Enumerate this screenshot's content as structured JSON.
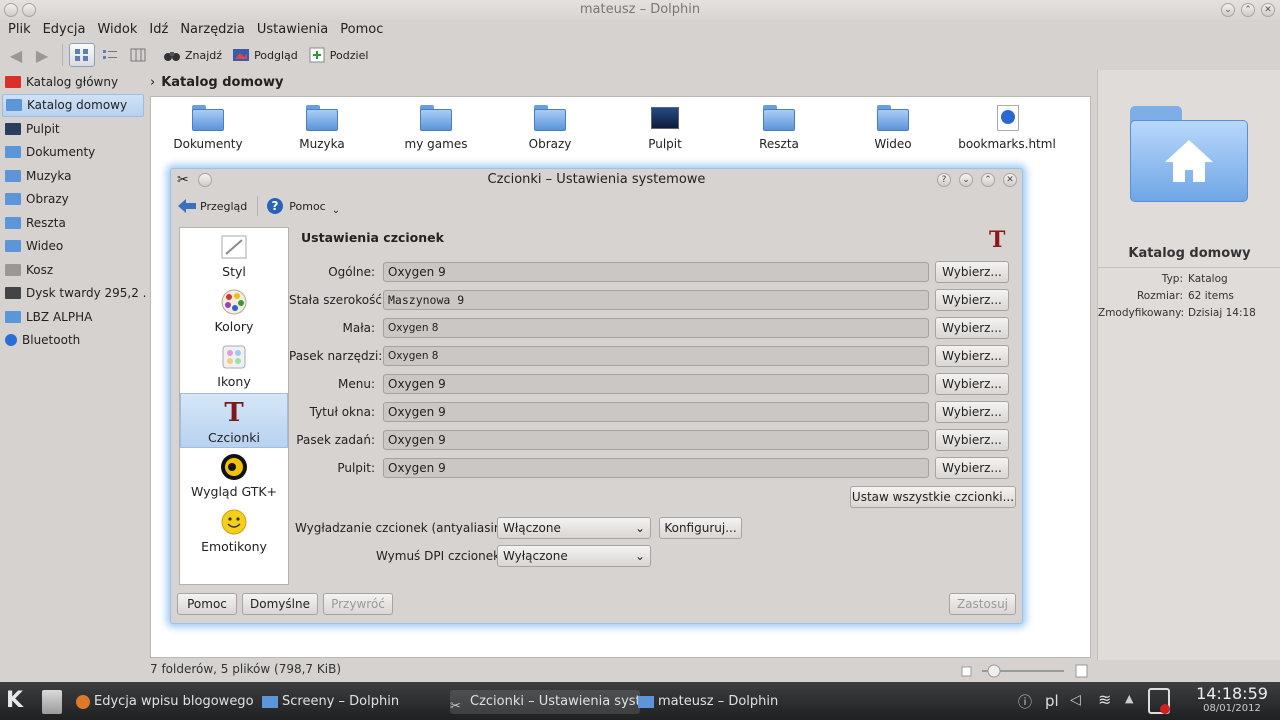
{
  "window": {
    "title": "mateusz – Dolphin"
  },
  "menu": [
    "Plik",
    "Edycja",
    "Widok",
    "Idź",
    "Narzędzia",
    "Ustawienia",
    "Pomoc"
  ],
  "toolbar": {
    "find": "Znajdź",
    "preview": "Podgląd",
    "split": "Podziel"
  },
  "sidebar": {
    "items": [
      {
        "label": "Katalog główny",
        "icon": "red-folder-icon",
        "color": "#d9302c"
      },
      {
        "label": "Katalog domowy",
        "icon": "home-folder-icon",
        "color": "#5c95d8"
      },
      {
        "label": "Pulpit",
        "icon": "desktop-icon",
        "color": "#2a3e5e"
      },
      {
        "label": "Dokumenty",
        "icon": "folder-icon",
        "color": "#5c95d8"
      },
      {
        "label": "Muzyka",
        "icon": "folder-icon",
        "color": "#5c95d8"
      },
      {
        "label": "Obrazy",
        "icon": "folder-icon",
        "color": "#5c95d8"
      },
      {
        "label": "Reszta",
        "icon": "folder-icon",
        "color": "#5c95d8"
      },
      {
        "label": "Wideo",
        "icon": "folder-icon",
        "color": "#5c95d8"
      },
      {
        "label": "Kosz",
        "icon": "trash-icon",
        "color": "#9a9896"
      },
      {
        "label": "Dysk twardy 295,2 ...",
        "icon": "harddisk-icon",
        "color": "#444444"
      },
      {
        "label": "LBZ ALPHA",
        "icon": "folder-icon",
        "color": "#5c95d8"
      },
      {
        "label": "Bluetooth",
        "icon": "bluetooth-icon",
        "color": "#2b6fd6"
      }
    ]
  },
  "breadcrumb": "Katalog domowy",
  "files": [
    {
      "name": "Dokumenty",
      "icon": "folder-icon"
    },
    {
      "name": "Muzyka",
      "icon": "folder-icon"
    },
    {
      "name": "my games",
      "icon": "folder-icon"
    },
    {
      "name": "Obrazy",
      "icon": "folder-icon"
    },
    {
      "name": "Pulpit",
      "icon": "desktop-icon"
    },
    {
      "name": "Reszta",
      "icon": "folder-icon"
    },
    {
      "name": "Wideo",
      "icon": "folder-icon"
    },
    {
      "name": "bookmarks.html",
      "icon": "html-file-icon"
    }
  ],
  "status": "7 folderów, 5 plików (798,7 KiB)",
  "info": {
    "title": "Katalog domowy",
    "rows": [
      {
        "k": "Typ:",
        "v": "Katalog"
      },
      {
        "k": "Rozmiar:",
        "v": "62 items"
      },
      {
        "k": "Zmodyfikowany:",
        "v": "Dzisiaj 14:18"
      }
    ]
  },
  "dialog": {
    "title": "Czcionki – Ustawienia systemowe",
    "toolbar": {
      "back": "Przegląd",
      "help": "Pomoc"
    },
    "categories": [
      {
        "label": "Styl",
        "icon": "style-icon"
      },
      {
        "label": "Kolory",
        "icon": "colors-icon"
      },
      {
        "label": "Ikony",
        "icon": "icons-icon"
      },
      {
        "label": "Czcionki",
        "icon": "fonts-icon"
      },
      {
        "label": "Wygląd GTK+",
        "icon": "gtk-icon"
      },
      {
        "label": "Emotikony",
        "icon": "emoticons-icon"
      }
    ],
    "heading": "Ustawienia czcionek",
    "fonts": [
      {
        "label": "Ogólne:",
        "value": "Oxygen 9",
        "style": ""
      },
      {
        "label": "Stała szerokość:",
        "value": "Maszynowa 9",
        "style": "mono"
      },
      {
        "label": "Mała:",
        "value": "Oxygen 8",
        "style": "small"
      },
      {
        "label": "Pasek narzędzi:",
        "value": "Oxygen 8",
        "style": "small"
      },
      {
        "label": "Menu:",
        "value": "Oxygen 9",
        "style": ""
      },
      {
        "label": "Tytuł okna:",
        "value": "Oxygen 9",
        "style": ""
      },
      {
        "label": "Pasek zadań:",
        "value": "Oxygen 9",
        "style": ""
      },
      {
        "label": "Pulpit:",
        "value": "Oxygen 9",
        "style": ""
      }
    ],
    "choose": "Wybierz...",
    "set_all": "Ustaw wszystkie czcionki...",
    "aa_label": "Wygładzanie czcionek (antyaliasing):",
    "aa_value": "Włączone",
    "configure": "Konfiguruj...",
    "dpi_label": "Wymuś DPI czcionek:",
    "dpi_value": "Wyłączone",
    "help": "Pomoc",
    "defaults": "Domyślne",
    "reset": "Przywróć",
    "apply": "Zastosuj"
  },
  "taskbar": {
    "tasks": [
      "Edycja wpisu blogowego – do",
      "Screeny – Dolphin",
      "Czcionki – Ustawienia syste",
      "mateusz – Dolphin"
    ],
    "lang": "pl",
    "time": "14:18:59",
    "date": "08/01/2012"
  }
}
